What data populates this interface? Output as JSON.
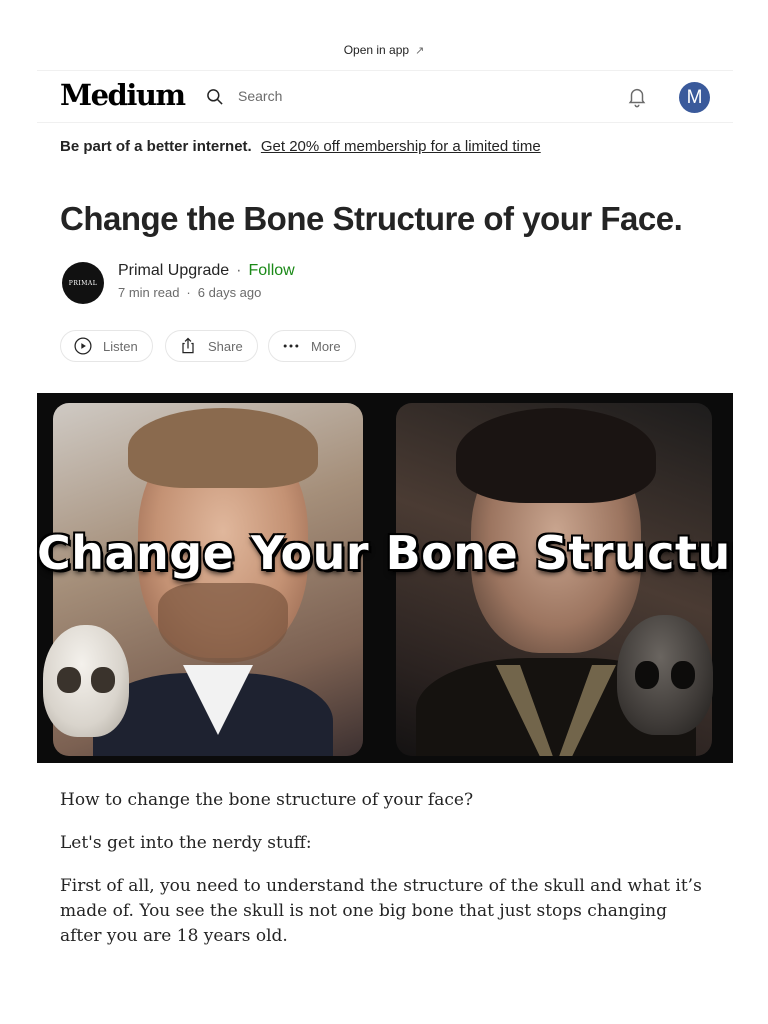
{
  "top_banner": {
    "open_in_app": "Open in app",
    "arrow": "↗"
  },
  "header": {
    "logo": "Medium",
    "search_placeholder": "Search",
    "user_initial": "M"
  },
  "promo": {
    "lead": "Be part of a better internet.",
    "link": "Get 20% off membership for a limited time"
  },
  "article": {
    "title": "Change the Bone Structure of your Face.",
    "author": {
      "name": "Primal Upgrade",
      "follow": "Follow",
      "avatar_text": "PRIMAL",
      "read_time": "7 min read",
      "published": "6 days ago"
    },
    "actions": {
      "listen": "Listen",
      "share": "Share",
      "more": "More"
    },
    "hero_text": "Change Your Bone Structure",
    "paragraphs": [
      "How to change the bone structure of your face?",
      "Let's get into the nerdy stuff:",
      "First of all, you need to understand the structure of the skull and what it’s made of. You see the skull is not one big bone that just stops changing after you are 18 years old."
    ]
  },
  "colors": {
    "follow_green": "#1a8917",
    "text": "#242424",
    "muted": "#6b6b6b",
    "avatar_blue": "#3a5a9b"
  }
}
